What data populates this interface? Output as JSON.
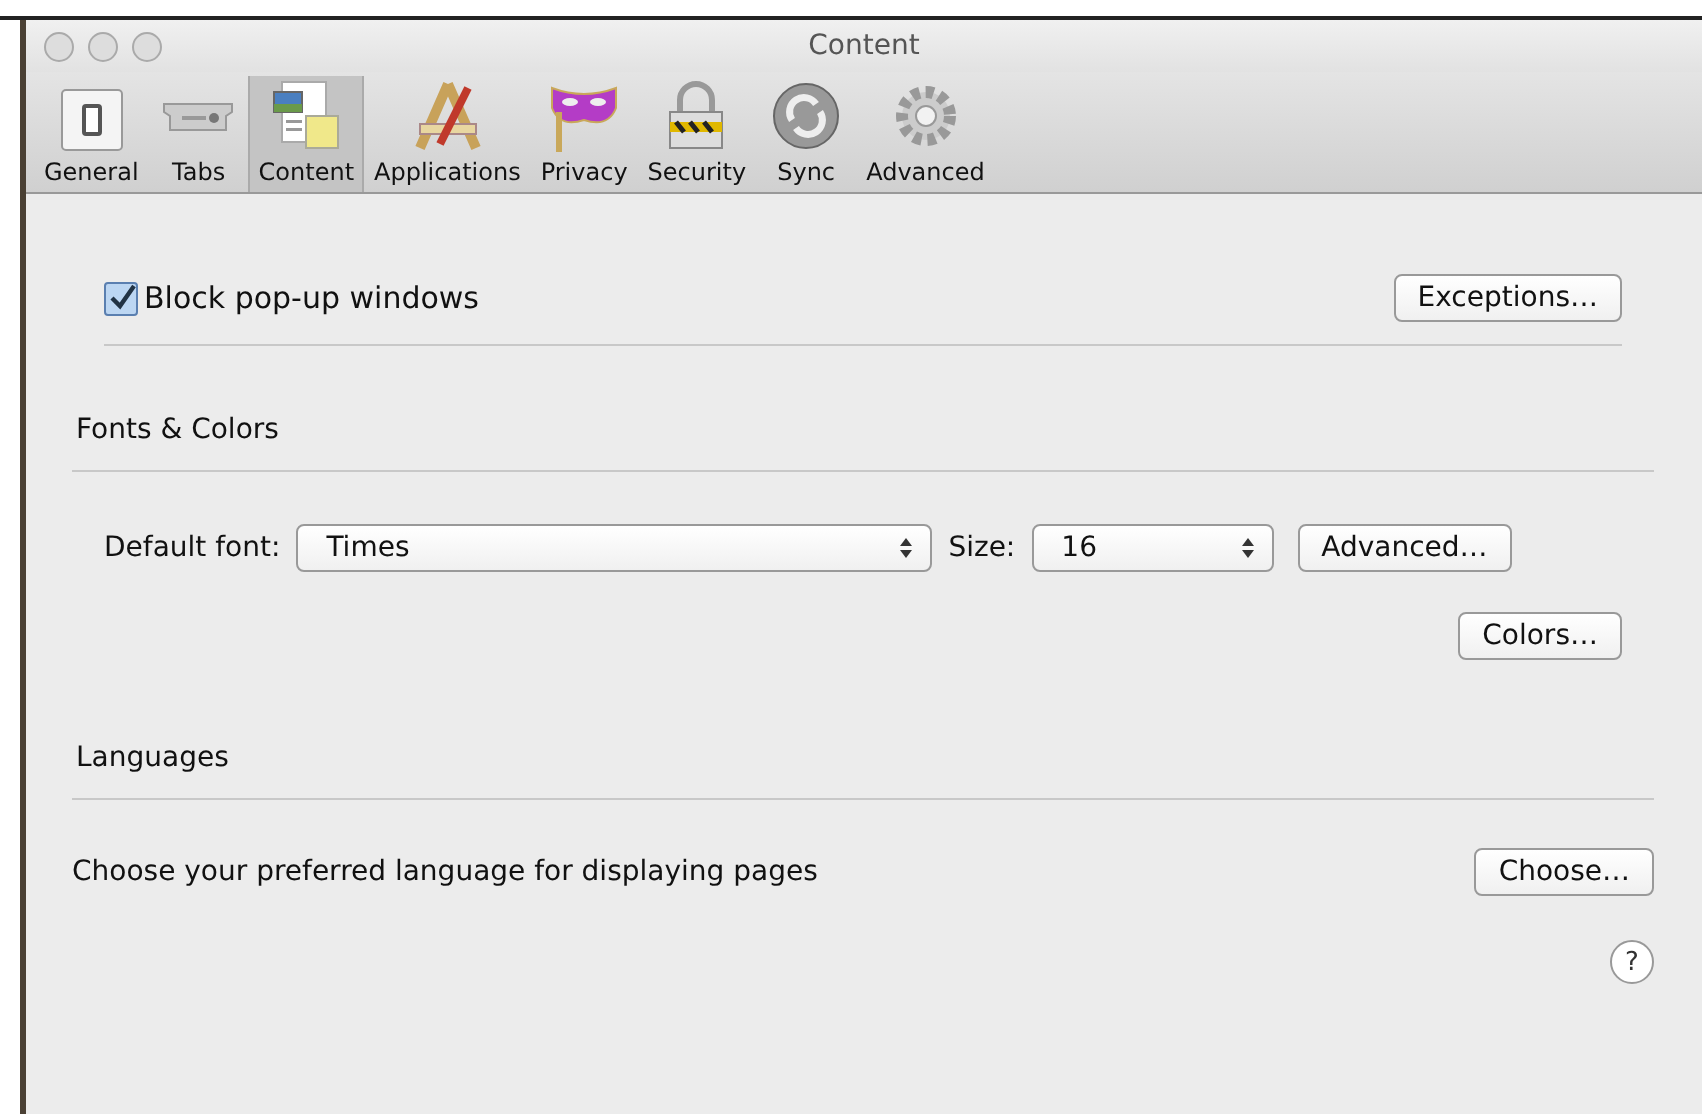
{
  "window": {
    "title": "Content"
  },
  "toolbar": [
    {
      "label": "General",
      "kind": "switch",
      "selected": false
    },
    {
      "label": "Tabs",
      "kind": "tabs",
      "selected": false
    },
    {
      "label": "Content",
      "kind": "content",
      "selected": true
    },
    {
      "label": "Applications",
      "kind": "applications",
      "selected": false
    },
    {
      "label": "Privacy",
      "kind": "mask",
      "selected": false
    },
    {
      "label": "Security",
      "kind": "lock",
      "selected": false
    },
    {
      "label": "Sync",
      "kind": "sync",
      "selected": false
    },
    {
      "label": "Advanced",
      "kind": "gear",
      "selected": false
    }
  ],
  "popups": {
    "label": "Block pop-up windows",
    "checked": true,
    "button": "Exceptions…"
  },
  "fonts": {
    "heading": "Fonts & Colors",
    "font_label": "Default font:",
    "font_value": "Times",
    "size_label": "Size:",
    "size_value": "16",
    "advanced_button": "Advanced…",
    "colors_button": "Colors…"
  },
  "languages": {
    "heading": "Languages",
    "text": "Choose your preferred language for displaying pages",
    "button": "Choose…"
  },
  "help": {
    "label": "?"
  }
}
